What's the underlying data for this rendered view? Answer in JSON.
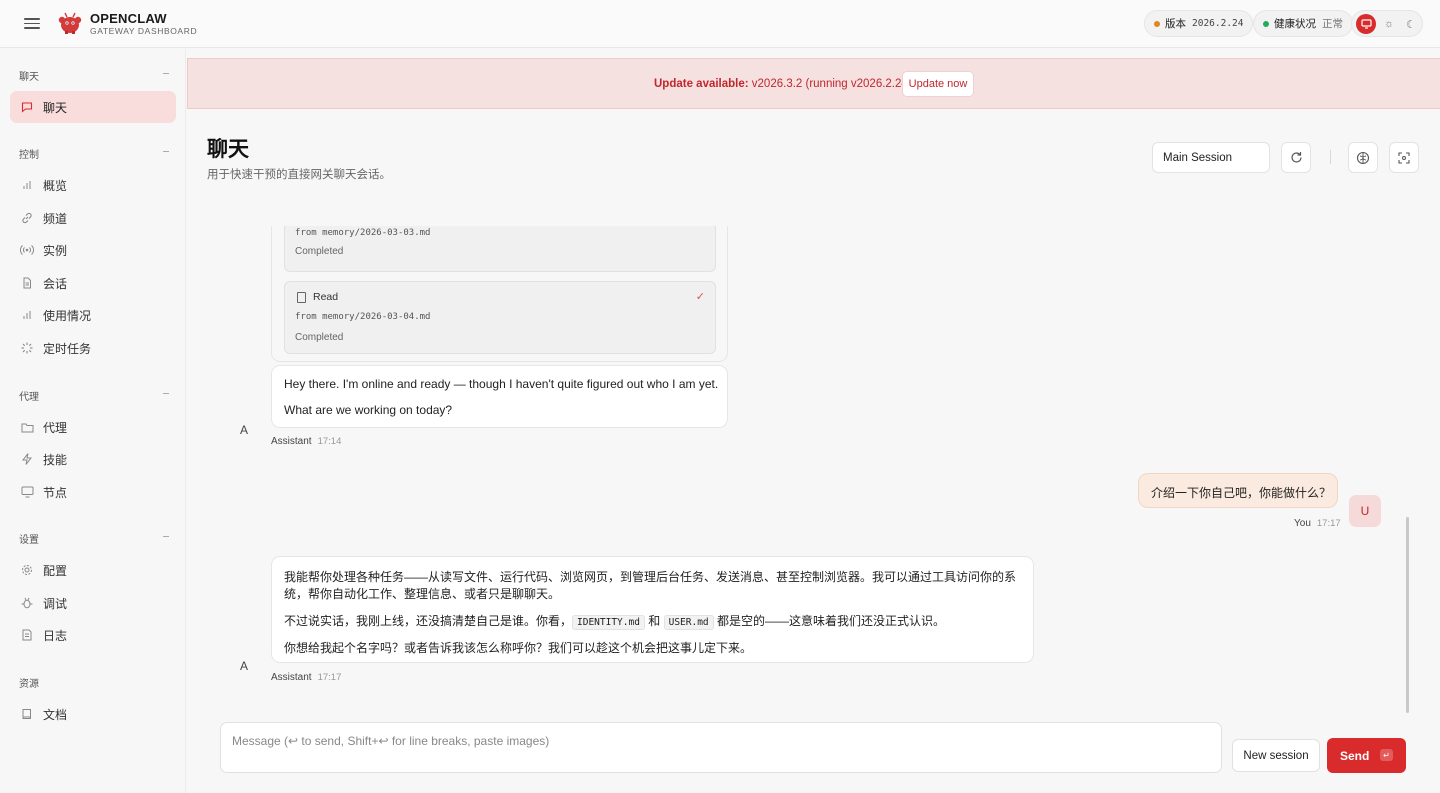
{
  "topbar": {
    "brand_title": "OPENCLAW",
    "brand_subtitle": "GATEWAY DASHBOARD",
    "version_label": "版本",
    "version_value": "2026.2.24",
    "health_label": "健康状况",
    "health_value": "正常"
  },
  "sidebar": {
    "sections": [
      {
        "title": "聊天",
        "items": [
          {
            "label": "聊天",
            "icon": "chat-icon",
            "active": true
          }
        ]
      },
      {
        "title": "控制",
        "items": [
          {
            "label": "概览",
            "icon": "bar-chart-icon"
          },
          {
            "label": "频道",
            "icon": "link-icon"
          },
          {
            "label": "实例",
            "icon": "broadcast-icon"
          },
          {
            "label": "会话",
            "icon": "document-icon"
          },
          {
            "label": "使用情况",
            "icon": "bar-chart-icon"
          },
          {
            "label": "定时任务",
            "icon": "loader-icon"
          }
        ]
      },
      {
        "title": "代理",
        "items": [
          {
            "label": "代理",
            "icon": "folder-icon"
          },
          {
            "label": "技能",
            "icon": "bolt-icon"
          },
          {
            "label": "节点",
            "icon": "monitor-icon"
          }
        ]
      },
      {
        "title": "设置",
        "items": [
          {
            "label": "配置",
            "icon": "gear-icon"
          },
          {
            "label": "调试",
            "icon": "bug-icon"
          },
          {
            "label": "日志",
            "icon": "log-icon"
          }
        ]
      },
      {
        "title": "资源",
        "items": [
          {
            "label": "文档",
            "icon": "book-icon"
          }
        ]
      }
    ]
  },
  "banner": {
    "prefix": "Update available:",
    "text": " v2026.3.2 (running v2026.2.24).",
    "button": "Update now"
  },
  "header": {
    "title": "聊天",
    "subtitle": "用于快速干预的直接网关聊天会话。",
    "session_select": "Main Session"
  },
  "chat": {
    "tool_cards": [
      {
        "from": "from memory/2026-03-03.md",
        "status": "Completed"
      },
      {
        "name": "Read",
        "from": "from memory/2026-03-04.md",
        "status": "Completed"
      }
    ],
    "messages": [
      {
        "role": "Assistant",
        "avatar": "A",
        "time": "17:14",
        "lines": [
          "Hey there. I'm online and ready — though I haven't quite figured out who I am yet.",
          "What are we working on today?"
        ]
      },
      {
        "role": "You",
        "avatar": "U",
        "time": "17:17",
        "text": "介绍一下你自己吧，你能做什么？"
      },
      {
        "role": "Assistant",
        "avatar": "A",
        "time": "17:17",
        "line1": "我能帮你处理各种任务——从读写文件、运行代码、浏览网页，到管理后台任务、发送消息、甚至控制浏览器。我可以通过工具访问你的系",
        "line2": "统，帮你自动化工作、整理信息、或者只是聊聊天。",
        "line3_a": "不过说实话，我刚上线，还没搞清楚自己是谁。你看，",
        "code1": "IDENTITY.md",
        "line3_b": " 和 ",
        "code2": "USER.md",
        "line3_c": " 都是空的——这意味着我们还没正式认识。",
        "line4": "你想给我起个名字吗？或者告诉我该怎么称呼你？我们可以趁这个机会把这事儿定下来。"
      }
    ]
  },
  "composer": {
    "placeholder": "Message (↩ to send, Shift+↩ for line breaks, paste images)",
    "new_session": "New session",
    "send": "Send",
    "send_kbd": "↵"
  },
  "colors": {
    "accent": "#d92b2b",
    "banner_bg": "#f6e1e1",
    "user_bubble": "#fbeadf"
  }
}
